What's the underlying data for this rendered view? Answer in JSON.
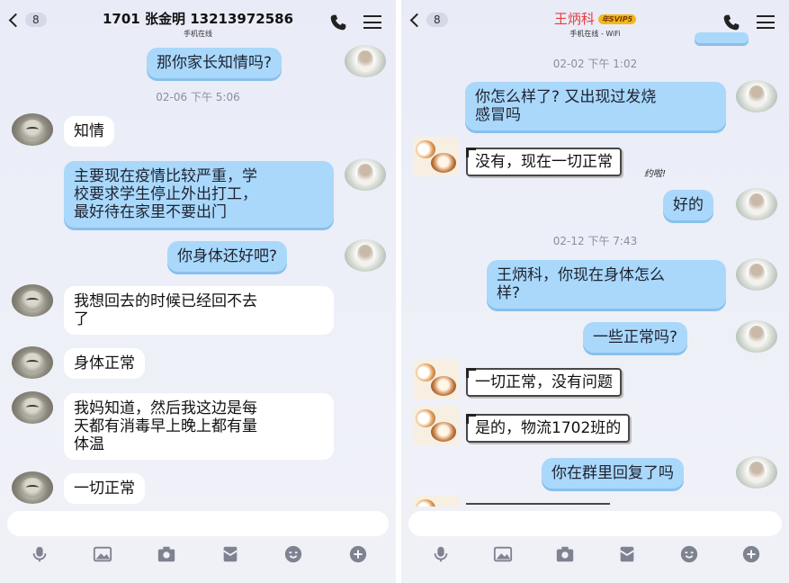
{
  "left": {
    "header": {
      "unread": "8",
      "title": "1701   张金明 13213972586",
      "status": "手机在线"
    },
    "timestamps": [
      {
        "text": "02-06 下午 5:06"
      }
    ],
    "messages": [
      {
        "text": "那你家长知情吗?"
      },
      {
        "text": "知情"
      },
      {
        "text": "主要现在疫情比较严重，学\n校要求学生停止外出打工，\n最好待在家里不要出门"
      },
      {
        "text": "你身体还好吧?"
      },
      {
        "text": "我想回去的时候已经回不去\n了"
      },
      {
        "text": "身体正常"
      },
      {
        "text": "我妈知道，然后我这边是每\n天都有消毒早上晚上都有量\n体温"
      },
      {
        "text": "一切正常"
      }
    ],
    "toolbar": [
      "mic-icon",
      "image-icon",
      "camera-icon",
      "red-packet-icon",
      "emoji-icon",
      "plus-icon"
    ]
  },
  "right": {
    "header": {
      "unread": "8",
      "title": "王炳科",
      "badge": "年SVIP5",
      "status": "手机在线 - WiFi"
    },
    "timestamps": [
      {
        "text": "02-02 下午 1:02"
      },
      {
        "text": "02-12 下午 7:43"
      }
    ],
    "messages": [
      {
        "text": "你怎么样了? 又出现过发烧\n感冒吗"
      },
      {
        "text": "没有，现在一切正常"
      },
      {
        "text": "好的"
      },
      {
        "text": "王炳科，你现在身体怎么\n样?"
      },
      {
        "text": "一些正常吗?"
      },
      {
        "text": "一切正常，没有问题"
      },
      {
        "text": "是的，物流1702班的"
      },
      {
        "text": "你在群里回复了吗"
      }
    ],
    "decorations": {
      "sticker_label": "约啦!"
    },
    "toolbar": [
      "mic-icon",
      "image-icon",
      "camera-icon",
      "red-packet-icon",
      "emoji-icon",
      "plus-icon"
    ]
  },
  "colors": {
    "self_bubble": "#a9d8fb",
    "other_bubble": "#ffffff",
    "title_red": "#e63c3c",
    "svip_gold": "#f2b81c"
  }
}
